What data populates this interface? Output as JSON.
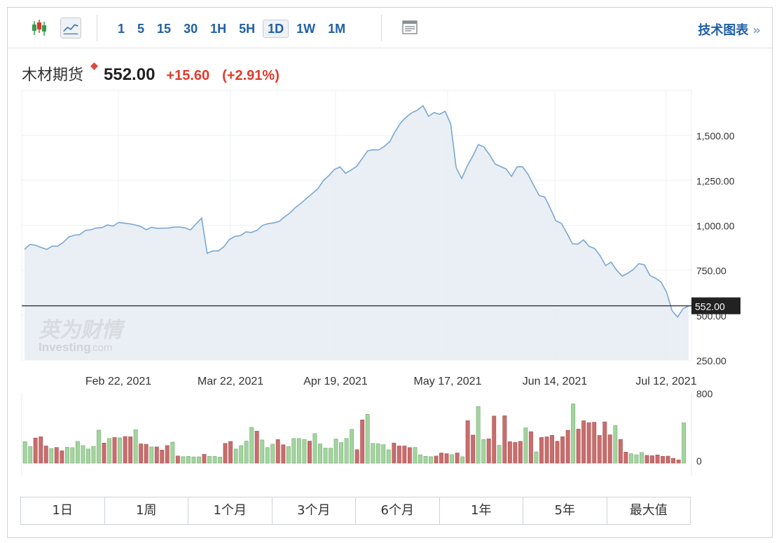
{
  "toolbar": {
    "intervals": [
      "1",
      "5",
      "15",
      "30",
      "1H",
      "5H",
      "1D",
      "1W",
      "1M"
    ],
    "active_interval": "1D",
    "tech_chart_label": "技术图表",
    "tech_chart_arrow": "»"
  },
  "quote": {
    "name": "木材期货",
    "price": "552.00",
    "change": "+15.60",
    "change_pct": "(+2.91%)"
  },
  "watermark": {
    "cn": "英为财情",
    "en": "Investing",
    "en_suffix": ".com"
  },
  "colors": {
    "line": "#7aa8d4",
    "area": "#e6ecf3",
    "price_line": "#222222",
    "price_tag": "#222222",
    "vol_up": "#a4d3a0",
    "vol_up_stroke": "#6fae6a",
    "vol_down": "#c96d6d",
    "vol_down_stroke": "#a84e4e",
    "accent": "#1f5fa7",
    "negative": "#e23b2c"
  },
  "chart_data": {
    "type": "line",
    "x_labels": [
      "Feb 22, 2021",
      "Mar 22, 2021",
      "Apr 19, 2021",
      "May 17, 2021",
      "Jun 14, 2021",
      "Jul 12, 2021"
    ],
    "y_ticks": [
      "1,500.00",
      "1,250.00",
      "1,000.00",
      "750.00",
      "500.00",
      "250.00"
    ],
    "ylim": [
      250,
      1750
    ],
    "last_price_label": "552.00",
    "last_price": 552,
    "values": [
      866,
      894,
      889,
      876,
      866,
      884,
      884,
      905,
      935,
      945,
      948,
      971,
      975,
      985,
      987,
      1002,
      995,
      1016,
      1012,
      1008,
      1002,
      993,
      975,
      989,
      983,
      984,
      985,
      990,
      990,
      986,
      974,
      1008,
      1040,
      844,
      857,
      857,
      880,
      920,
      938,
      942,
      963,
      960,
      972,
      999,
      1009,
      1013,
      1021,
      1047,
      1069,
      1100,
      1123,
      1151,
      1177,
      1203,
      1248,
      1277,
      1310,
      1325,
      1289,
      1307,
      1327,
      1370,
      1414,
      1420,
      1419,
      1438,
      1465,
      1523,
      1571,
      1602,
      1626,
      1640,
      1665,
      1606,
      1627,
      1617,
      1634,
      1565,
      1320,
      1260,
      1330,
      1385,
      1449,
      1436,
      1393,
      1342,
      1327,
      1314,
      1272,
      1325,
      1325,
      1283,
      1222,
      1165,
      1157,
      1095,
      1025,
      1011,
      956,
      897,
      895,
      919,
      883,
      871,
      831,
      776,
      795,
      750,
      717,
      733,
      754,
      787,
      780,
      722,
      706,
      685,
      629,
      525,
      490,
      536,
      552
    ],
    "volume": {
      "ylim": [
        0,
        800
      ],
      "y_ticks": [
        "800",
        "0"
      ],
      "bars": [
        {
          "v": 245,
          "d": "u"
        },
        {
          "v": 188,
          "d": "u"
        },
        {
          "v": 287,
          "d": "d"
        },
        {
          "v": 301,
          "d": "d"
        },
        {
          "v": 196,
          "d": "d"
        },
        {
          "v": 167,
          "d": "u"
        },
        {
          "v": 179,
          "d": "d"
        },
        {
          "v": 141,
          "d": "d"
        },
        {
          "v": 181,
          "d": "u"
        },
        {
          "v": 177,
          "d": "u"
        },
        {
          "v": 248,
          "d": "u"
        },
        {
          "v": 201,
          "d": "u"
        },
        {
          "v": 162,
          "d": "u"
        },
        {
          "v": 191,
          "d": "u"
        },
        {
          "v": 377,
          "d": "u"
        },
        {
          "v": 230,
          "d": "d"
        },
        {
          "v": 282,
          "d": "u"
        },
        {
          "v": 293,
          "d": "d"
        },
        {
          "v": 290,
          "d": "u"
        },
        {
          "v": 304,
          "d": "d"
        },
        {
          "v": 301,
          "d": "d"
        },
        {
          "v": 382,
          "d": "u"
        },
        {
          "v": 220,
          "d": "d"
        },
        {
          "v": 215,
          "d": "d"
        },
        {
          "v": 185,
          "d": "u"
        },
        {
          "v": 185,
          "d": "d"
        },
        {
          "v": 150,
          "d": "d"
        },
        {
          "v": 201,
          "d": "d"
        },
        {
          "v": 240,
          "d": "u"
        },
        {
          "v": 82,
          "d": "d"
        },
        {
          "v": 74,
          "d": "u"
        },
        {
          "v": 77,
          "d": "u"
        },
        {
          "v": 71,
          "d": "u"
        },
        {
          "v": 72,
          "d": "u"
        },
        {
          "v": 101,
          "d": "d"
        },
        {
          "v": 77,
          "d": "u"
        },
        {
          "v": 77,
          "d": "u"
        },
        {
          "v": 69,
          "d": "u"
        },
        {
          "v": 226,
          "d": "d"
        },
        {
          "v": 247,
          "d": "d"
        },
        {
          "v": 162,
          "d": "u"
        },
        {
          "v": 200,
          "d": "u"
        },
        {
          "v": 252,
          "d": "u"
        },
        {
          "v": 408,
          "d": "u"
        },
        {
          "v": 365,
          "d": "d"
        },
        {
          "v": 265,
          "d": "u"
        },
        {
          "v": 178,
          "d": "u"
        },
        {
          "v": 217,
          "d": "u"
        },
        {
          "v": 269,
          "d": "d"
        },
        {
          "v": 210,
          "d": "d"
        },
        {
          "v": 189,
          "d": "u"
        },
        {
          "v": 282,
          "d": "u"
        },
        {
          "v": 281,
          "d": "u"
        },
        {
          "v": 270,
          "d": "u"
        },
        {
          "v": 251,
          "d": "d"
        },
        {
          "v": 338,
          "d": "u"
        },
        {
          "v": 219,
          "d": "u"
        },
        {
          "v": 172,
          "d": "u"
        },
        {
          "v": 171,
          "d": "u"
        },
        {
          "v": 276,
          "d": "u"
        },
        {
          "v": 235,
          "d": "u"
        },
        {
          "v": 282,
          "d": "u"
        },
        {
          "v": 386,
          "d": "u"
        },
        {
          "v": 154,
          "d": "d"
        },
        {
          "v": 494,
          "d": "d"
        },
        {
          "v": 558,
          "d": "u"
        },
        {
          "v": 225,
          "d": "u"
        },
        {
          "v": 221,
          "d": "u"
        },
        {
          "v": 211,
          "d": "u"
        },
        {
          "v": 152,
          "d": "u"
        },
        {
          "v": 230,
          "d": "d"
        },
        {
          "v": 196,
          "d": "d"
        },
        {
          "v": 196,
          "d": "d"
        },
        {
          "v": 178,
          "d": "d"
        },
        {
          "v": 179,
          "d": "u"
        },
        {
          "v": 95,
          "d": "u"
        },
        {
          "v": 78,
          "d": "u"
        },
        {
          "v": 74,
          "d": "u"
        },
        {
          "v": 81,
          "d": "d"
        },
        {
          "v": 116,
          "d": "d"
        },
        {
          "v": 108,
          "d": "d"
        },
        {
          "v": 97,
          "d": "u"
        },
        {
          "v": 116,
          "d": "d"
        },
        {
          "v": 73,
          "d": "u"
        },
        {
          "v": 485,
          "d": "d"
        },
        {
          "v": 321,
          "d": "d"
        },
        {
          "v": 646,
          "d": "u"
        },
        {
          "v": 269,
          "d": "u"
        },
        {
          "v": 277,
          "d": "d"
        },
        {
          "v": 538,
          "d": "d"
        },
        {
          "v": 203,
          "d": "u"
        },
        {
          "v": 541,
          "d": "d"
        },
        {
          "v": 245,
          "d": "d"
        },
        {
          "v": 237,
          "d": "d"
        },
        {
          "v": 249,
          "d": "d"
        },
        {
          "v": 403,
          "d": "u"
        },
        {
          "v": 359,
          "d": "d"
        },
        {
          "v": 129,
          "d": "u"
        },
        {
          "v": 294,
          "d": "d"
        },
        {
          "v": 300,
          "d": "d"
        },
        {
          "v": 317,
          "d": "d"
        },
        {
          "v": 250,
          "d": "d"
        },
        {
          "v": 302,
          "d": "d"
        },
        {
          "v": 375,
          "d": "d"
        },
        {
          "v": 677,
          "d": "u"
        },
        {
          "v": 389,
          "d": "d"
        },
        {
          "v": 484,
          "d": "d"
        },
        {
          "v": 462,
          "d": "d"
        },
        {
          "v": 467,
          "d": "d"
        },
        {
          "v": 316,
          "d": "d"
        },
        {
          "v": 471,
          "d": "d"
        },
        {
          "v": 323,
          "d": "d"
        },
        {
          "v": 429,
          "d": "u"
        },
        {
          "v": 271,
          "d": "d"
        },
        {
          "v": 126,
          "d": "d"
        },
        {
          "v": 107,
          "d": "u"
        },
        {
          "v": 95,
          "d": "u"
        },
        {
          "v": 122,
          "d": "u"
        },
        {
          "v": 89,
          "d": "d"
        },
        {
          "v": 85,
          "d": "d"
        },
        {
          "v": 94,
          "d": "d"
        },
        {
          "v": 78,
          "d": "d"
        },
        {
          "v": 80,
          "d": "d"
        },
        {
          "v": 55,
          "d": "d"
        },
        {
          "v": 37,
          "d": "d"
        },
        {
          "v": 460,
          "d": "u"
        }
      ]
    }
  },
  "ranges": [
    "1日",
    "1周",
    "1个月",
    "3个月",
    "6个月",
    "1年",
    "5年",
    "最大值"
  ]
}
